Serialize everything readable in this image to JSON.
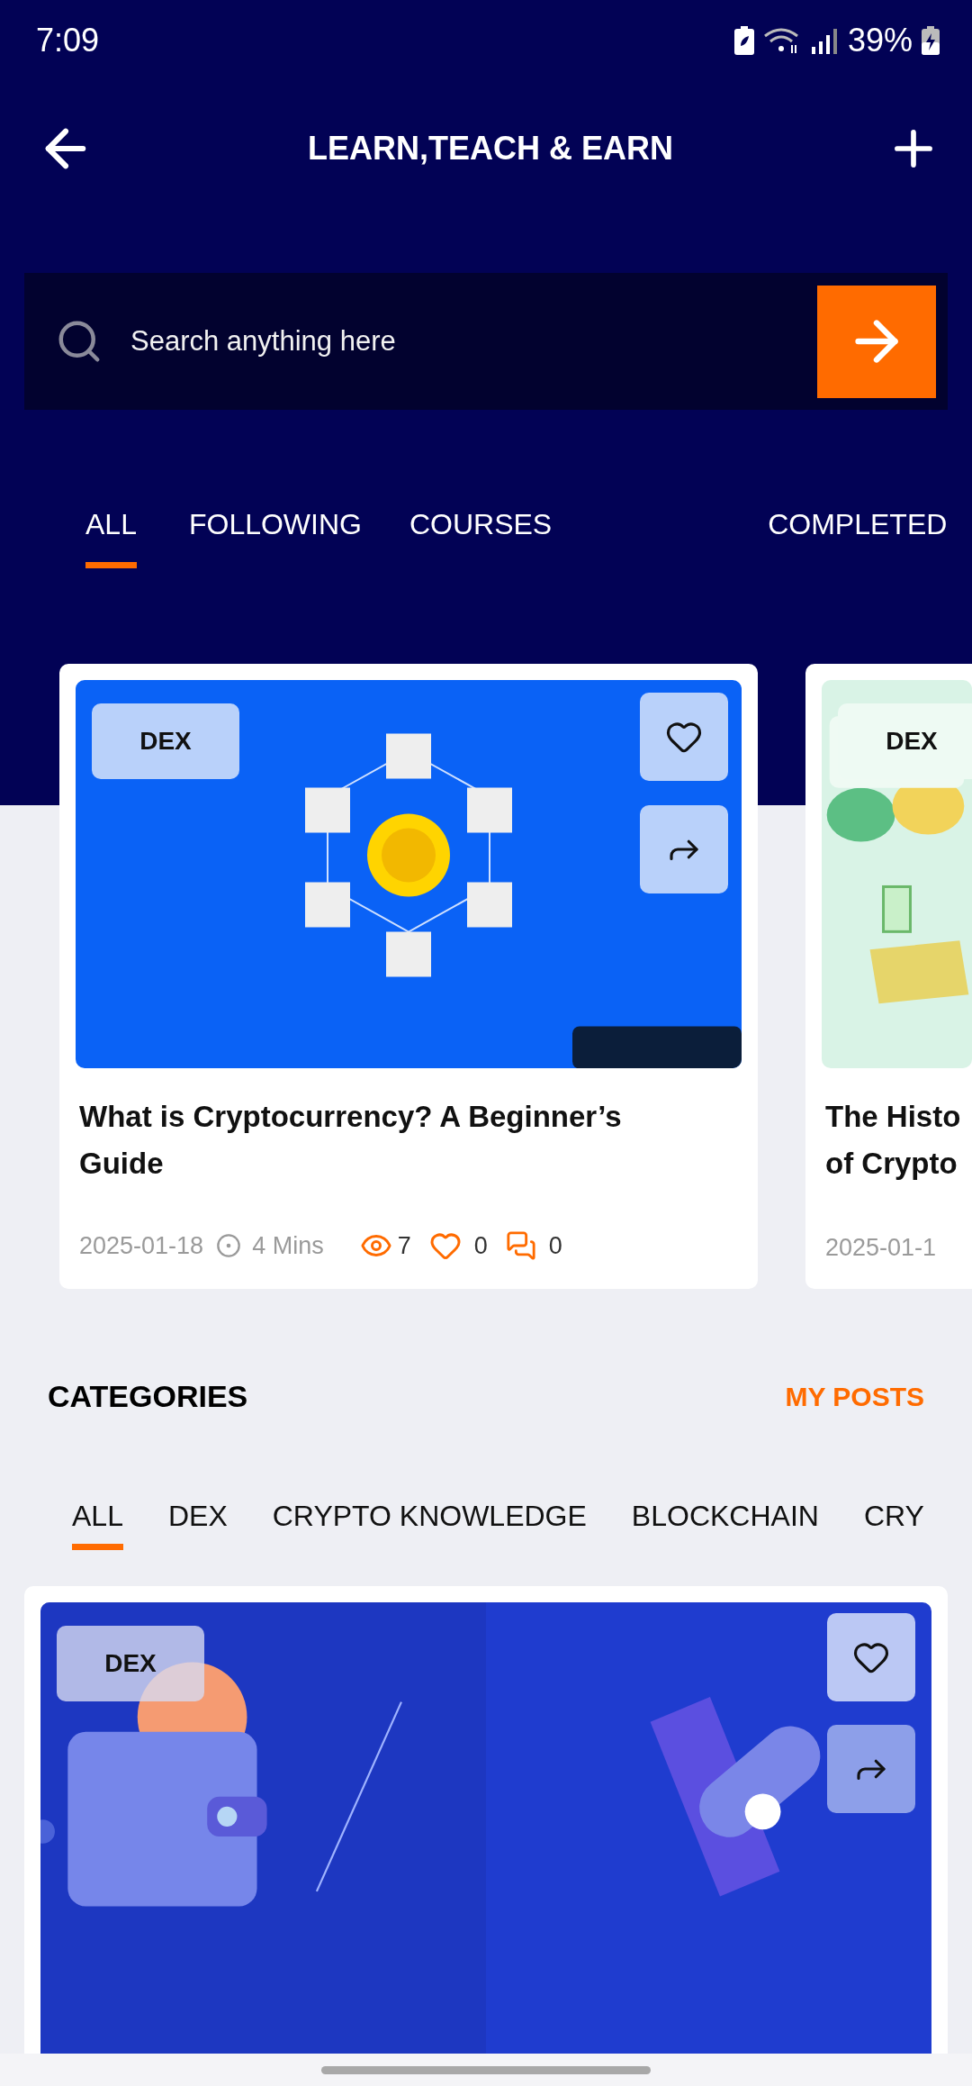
{
  "status_bar": {
    "time": "7:09",
    "battery": "39%"
  },
  "header": {
    "title": "LEARN,TEACH & EARN"
  },
  "search": {
    "placeholder": "Search anything here"
  },
  "tabs": [
    {
      "label": "ALL",
      "selected": true
    },
    {
      "label": "FOLLOWING",
      "selected": false
    },
    {
      "label": "COURSES",
      "selected": false
    },
    {
      "label": "COMPLETED",
      "selected": false
    }
  ],
  "featured": [
    {
      "kind": "network",
      "tag": "DEX",
      "title": "What is Cryptocurrency? A Beginner’s Guide",
      "date": "2025-01-18",
      "duration": "4 Mins",
      "views": "7",
      "likes": "0",
      "comments": "0"
    },
    {
      "kind": "shells",
      "tag": "DEX",
      "title": "The Histo\nof Crypto",
      "date": "2025-01-1"
    }
  ],
  "categories": {
    "title": "CATEGORIES",
    "link": "MY POSTS",
    "items": [
      {
        "label": "ALL",
        "selected": true
      },
      {
        "label": "DEX",
        "selected": false
      },
      {
        "label": "CRYPTO KNOWLEDGE",
        "selected": false
      },
      {
        "label": "BLOCKCHAIN",
        "selected": false
      },
      {
        "label": "CRY",
        "selected": false
      }
    ]
  },
  "posts": [
    {
      "kind": "wallets",
      "tag": "DEX"
    }
  ]
}
